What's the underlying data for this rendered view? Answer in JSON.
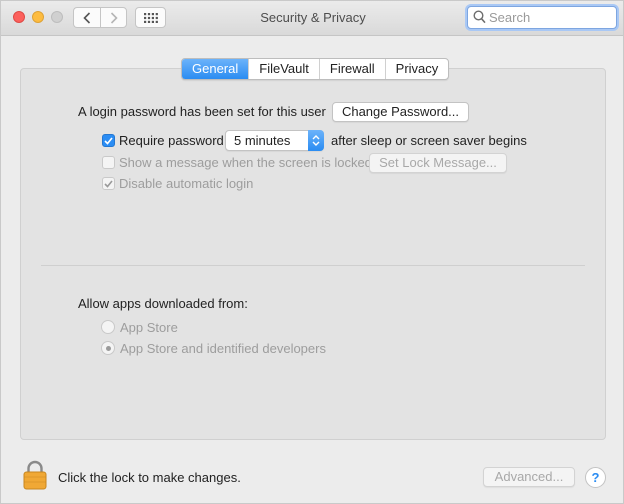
{
  "window": {
    "title": "Security & Privacy"
  },
  "search": {
    "placeholder": "Search",
    "value": ""
  },
  "tabs": [
    {
      "label": "General",
      "active": true
    },
    {
      "label": "FileVault",
      "active": false
    },
    {
      "label": "Firewall",
      "active": false
    },
    {
      "label": "Privacy",
      "active": false
    }
  ],
  "general": {
    "login_password_text": "A login password has been set for this user",
    "change_password_label": "Change Password...",
    "require_password": {
      "label": "Require password",
      "checked": true,
      "delay": "5 minutes",
      "suffix": "after sleep or screen saver begins"
    },
    "show_message": {
      "label": "Show a message when the screen is locked",
      "checked": false,
      "enabled": false
    },
    "set_lock_message_label": "Set Lock Message...",
    "disable_auto_login": {
      "label": "Disable automatic login",
      "checked": true,
      "enabled": false
    }
  },
  "allow_apps": {
    "heading": "Allow apps downloaded from:",
    "options": [
      {
        "label": "App Store",
        "selected": false
      },
      {
        "label": "App Store and identified developers",
        "selected": true
      }
    ]
  },
  "footer": {
    "lock_text": "Click the lock to make changes.",
    "advanced_label": "Advanced...",
    "help_label": "?"
  },
  "icons": {
    "back": "chevron-left-icon",
    "forward": "chevron-right-icon",
    "grid": "grid-icon",
    "search": "search-icon",
    "lock": "lock-icon",
    "checkmark": "checkmark-icon",
    "popup_arrows": "chevron-updown-icon"
  },
  "colors": {
    "accent": "#2a8cf2",
    "close": "#fc605c",
    "minimize": "#fdbc40",
    "lock": "#f0a835"
  }
}
